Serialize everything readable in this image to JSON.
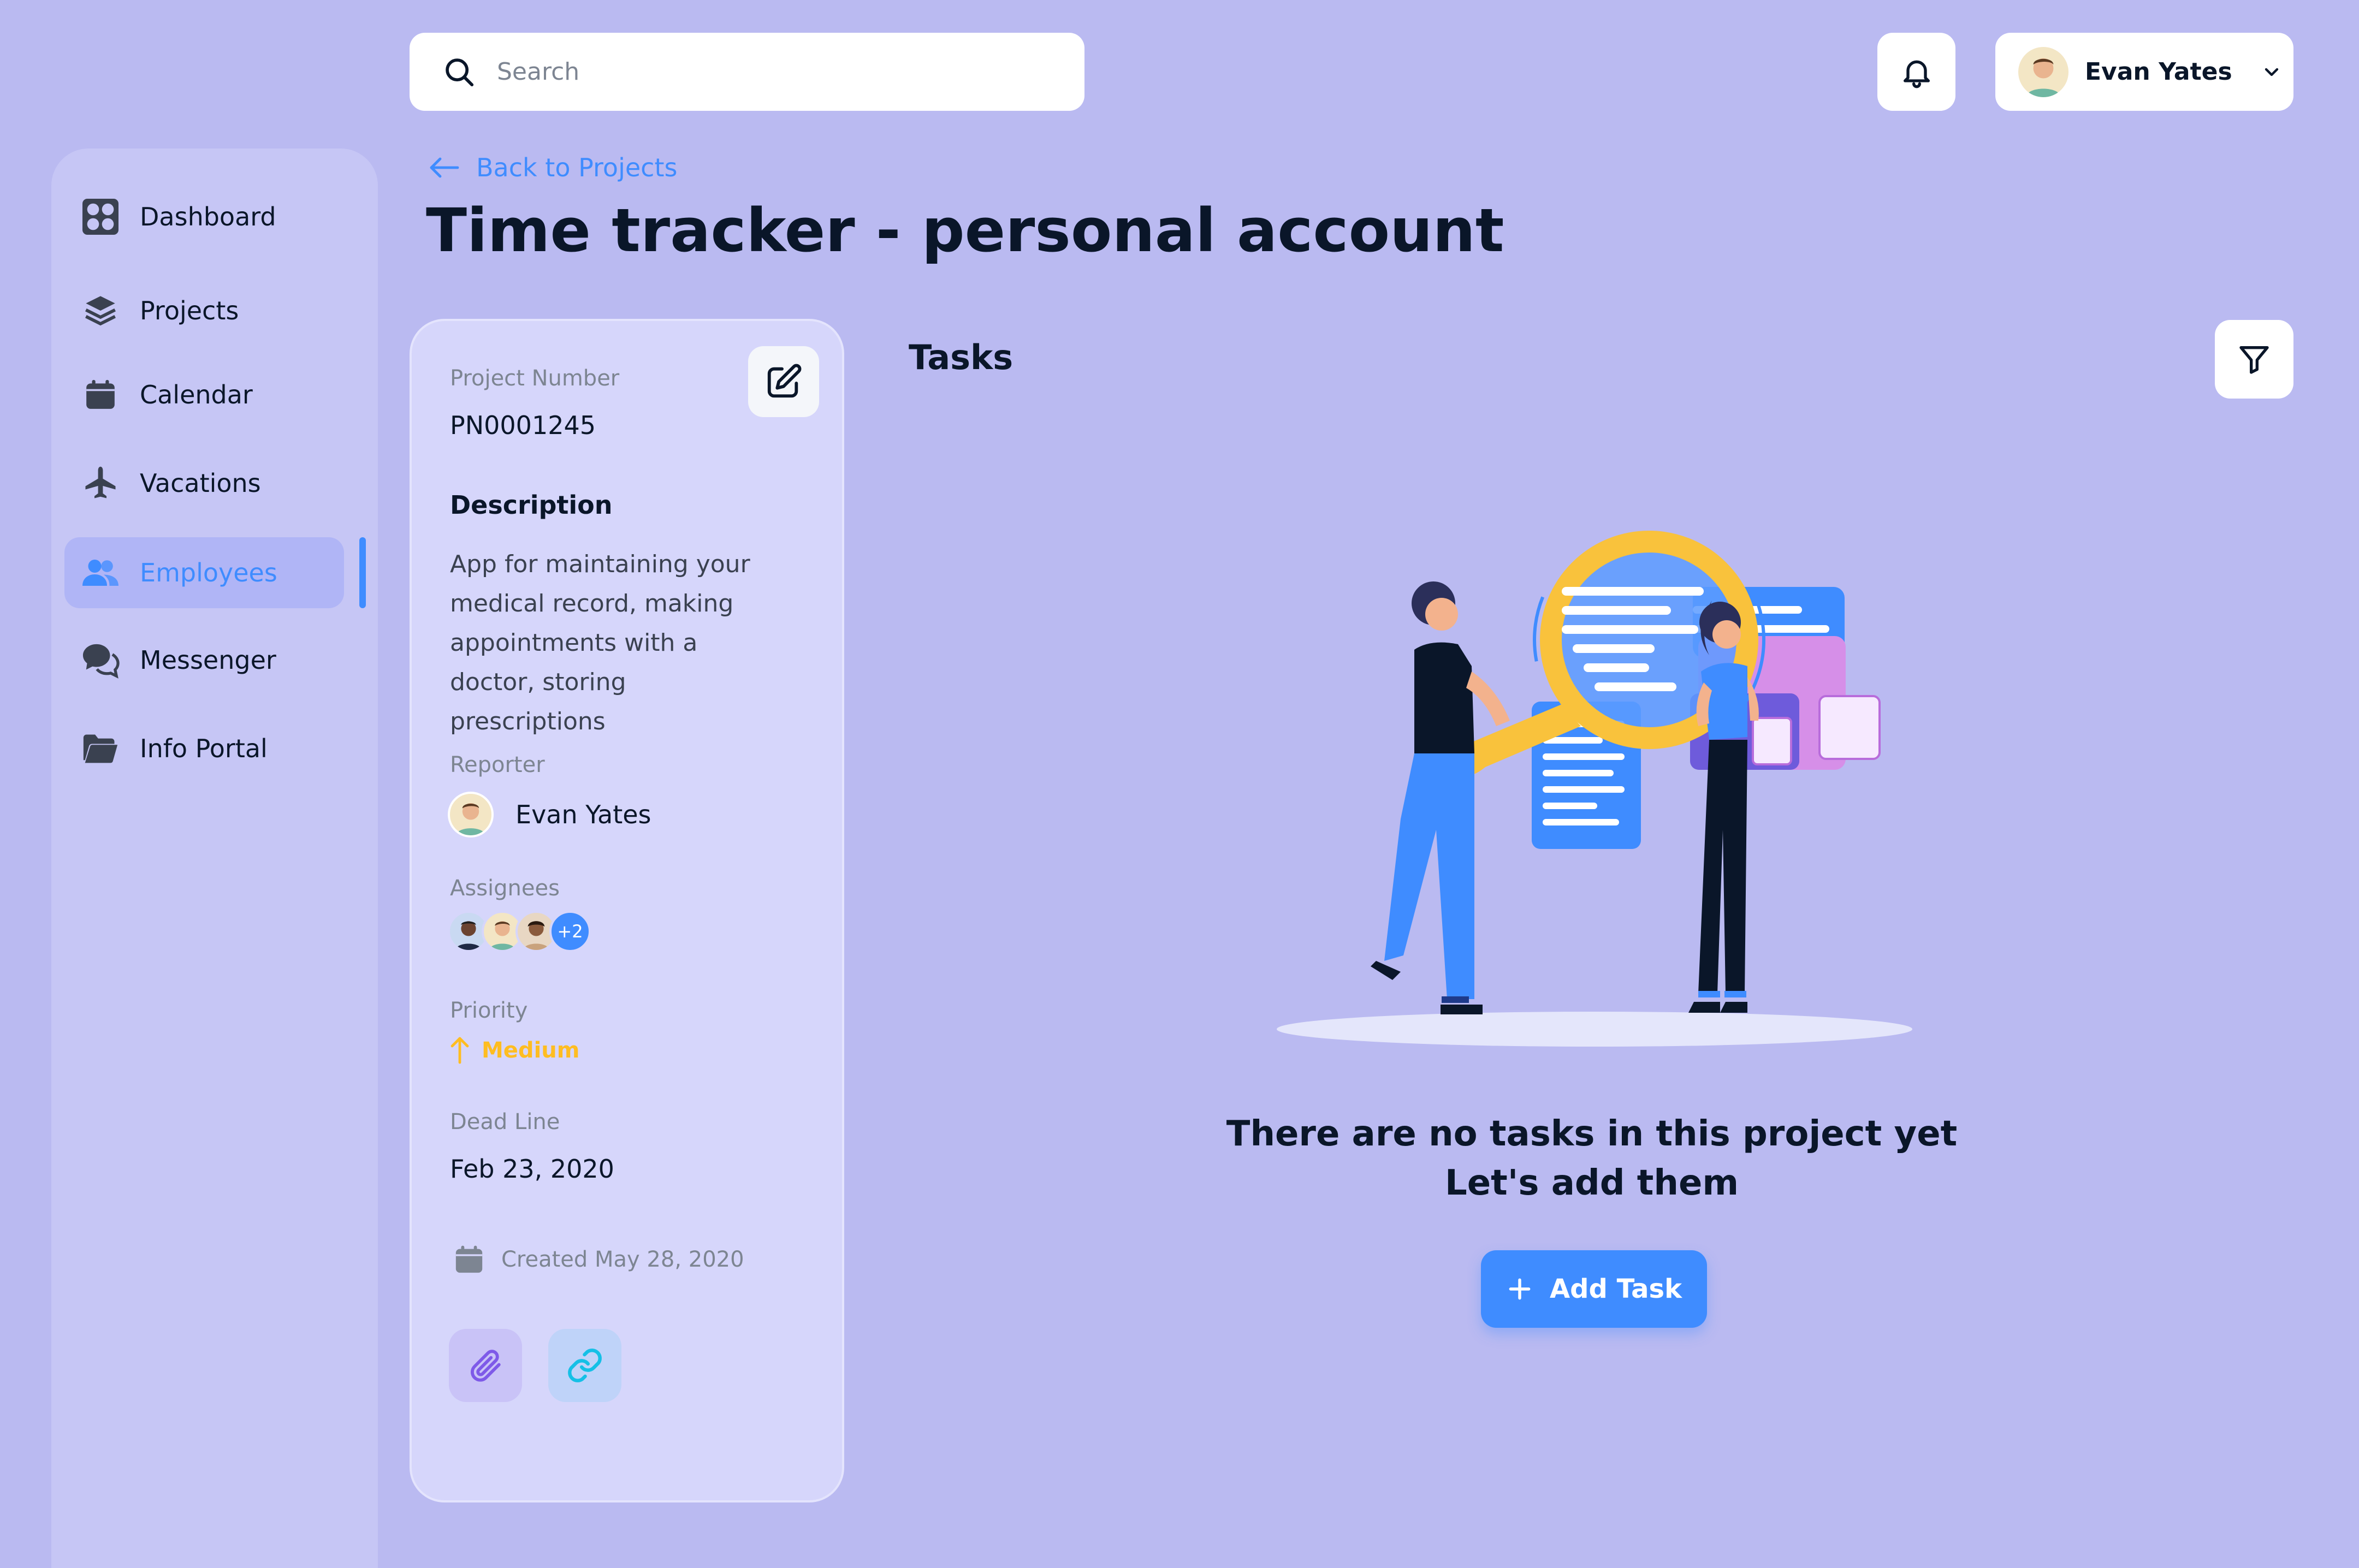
{
  "topbar": {
    "search_placeholder": "Search",
    "user_name": "Evan Yates"
  },
  "sidebar": {
    "items": [
      {
        "label": "Dashboard",
        "icon": "dashboard-icon"
      },
      {
        "label": "Projects",
        "icon": "layers-icon"
      },
      {
        "label": "Calendar",
        "icon": "calendar-icon"
      },
      {
        "label": "Vacations",
        "icon": "airplane-icon"
      },
      {
        "label": "Employees",
        "icon": "users-icon",
        "active": true
      },
      {
        "label": "Messenger",
        "icon": "chat-icon"
      },
      {
        "label": "Info Portal",
        "icon": "folder-icon"
      }
    ]
  },
  "header": {
    "back_label": "Back to Projects",
    "title": "Time tracker - personal account"
  },
  "project": {
    "number_label": "Project Number",
    "number_value": "PN0001245",
    "description_heading": "Description",
    "description": "App for maintaining your medical record, making appointments with a doctor, storing prescriptions",
    "reporter_label": "Reporter",
    "reporter_name": "Evan Yates",
    "assignees_label": "Assignees",
    "assignees_more": "+2",
    "priority_label": "Priority",
    "priority_value": "Medium",
    "deadline_label": "Dead Line",
    "deadline_value": "Feb 23, 2020",
    "created_text": "Created May 28, 2020"
  },
  "tasks": {
    "title": "Tasks",
    "empty_line1": "There are no tasks in this project yet",
    "empty_line2": "Let's add them",
    "add_button": "Add Task"
  },
  "colors": {
    "background": "#BABAF1",
    "accent": "#3F8CFF",
    "priority_medium": "#FFBD21",
    "text_primary": "#0A1629",
    "text_secondary": "#7D8592"
  }
}
